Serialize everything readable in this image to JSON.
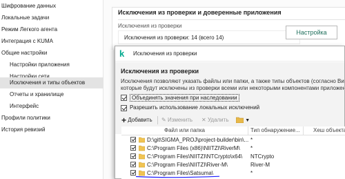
{
  "nav": {
    "items": [
      {
        "label": "Шифрование данных"
      },
      {
        "label": "Локальные задачи"
      },
      {
        "label": "Режим Легкого агента"
      },
      {
        "label": "Интеграция с KUMA"
      },
      {
        "label": "Общие настройки"
      },
      {
        "label": "Настройки приложения"
      },
      {
        "label": "Настройки сети"
      },
      {
        "label": "Исключения и типы объектов"
      },
      {
        "label": "Отчеты и хранилище"
      },
      {
        "label": "Интерфейс"
      },
      {
        "label": "Профили политики"
      },
      {
        "label": "История ревизий"
      }
    ]
  },
  "section": {
    "title": "Исключения из проверки и доверенные приложения",
    "exclusions_label": "Исключения из проверки",
    "exclusions_count": "Исключения из проверки: 14 (всего 14)",
    "settings_button": "Настройка"
  },
  "dialog": {
    "logo": "k",
    "title": "Исключения из проверки",
    "heading": "Исключения из проверки",
    "desc_line1": "Исключения позволяют указать файлы или папки, а также типы объектов (согласно Вирус",
    "desc_line2": "которые будут исключены из проверки всеми или некоторыми компонентами приложени",
    "opt_merge": "Объединять значения при наследовании",
    "opt_allow_local": "Разрешить использование локальных исключений",
    "toolbar": {
      "add": "Добавить",
      "edit": "Изменить",
      "delete": "Удалить"
    },
    "table": {
      "col_path": "Файл или папка",
      "col_type": "Тип обнаружение...",
      "col_hash": "Хеш объекта",
      "rows": [
        {
          "path": "D:\\git\\SIGMA_PROJ\\project-builder\\bin\\...",
          "type": "*"
        },
        {
          "path": "C:\\Program Files (x86)\\NIITZI\\RiverM\\",
          "type": "*"
        },
        {
          "path": "C:\\Program Files\\NIITZI\\NTCrypto\\x64\\",
          "type": "NTCrypto"
        },
        {
          "path": "C:\\Program Files\\NIITZI\\River-M\\",
          "type": "River-M"
        },
        {
          "path": "C:\\Program Files\\Satsuma\\",
          "type": "*"
        }
      ]
    }
  },
  "colors": {
    "brand": "#00a88e",
    "accent_text": "#1f6f5c",
    "selection": "#e3e3e3",
    "annotation": "#1a1aff"
  }
}
